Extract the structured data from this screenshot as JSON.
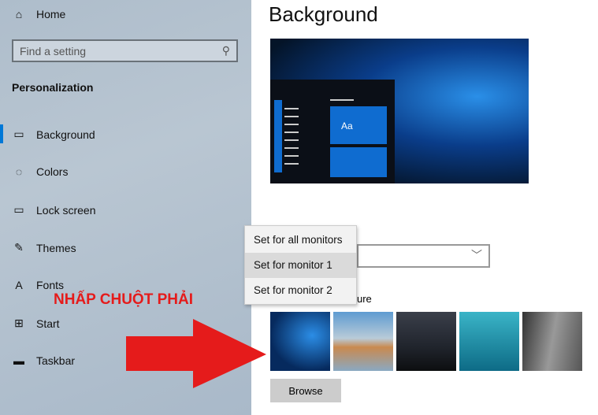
{
  "sidebar": {
    "home": "Home",
    "search_placeholder": "Find a setting",
    "section": "Personalization",
    "items": [
      {
        "label": "Background",
        "icon": "image-icon",
        "selected": true
      },
      {
        "label": "Colors",
        "icon": "palette-icon"
      },
      {
        "label": "Lock screen",
        "icon": "lock-screen-icon"
      },
      {
        "label": "Themes",
        "icon": "themes-icon"
      },
      {
        "label": "Fonts",
        "icon": "fonts-icon"
      },
      {
        "label": "Start",
        "icon": "start-icon"
      },
      {
        "label": "Taskbar",
        "icon": "taskbar-icon"
      }
    ]
  },
  "main": {
    "title": "Background",
    "preview_tile_label": "Aa",
    "choose_partial": "ure",
    "browse": "Browse"
  },
  "context_menu": {
    "items": [
      "Set for all monitors",
      "Set for monitor 1",
      "Set for monitor 2"
    ],
    "hovered": "Set for monitor 1"
  },
  "annotation": {
    "text": "NHẤP CHUỘT PHẢI",
    "color": "#e51b1b"
  },
  "colors": {
    "accent": "#0078d7"
  }
}
